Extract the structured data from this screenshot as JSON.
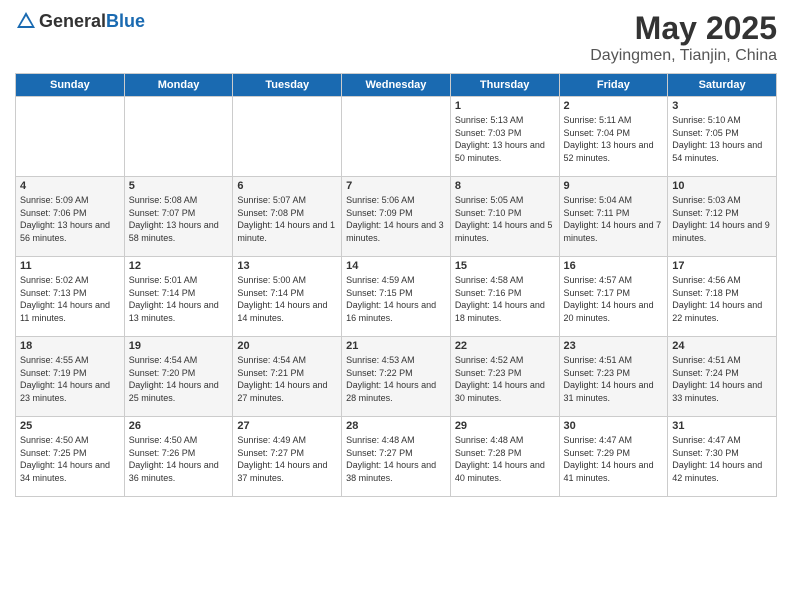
{
  "header": {
    "logo_general": "General",
    "logo_blue": "Blue",
    "month_title": "May 2025",
    "subtitle": "Dayingmen, Tianjin, China"
  },
  "days_of_week": [
    "Sunday",
    "Monday",
    "Tuesday",
    "Wednesday",
    "Thursday",
    "Friday",
    "Saturday"
  ],
  "weeks": [
    [
      {
        "day": "",
        "info": ""
      },
      {
        "day": "",
        "info": ""
      },
      {
        "day": "",
        "info": ""
      },
      {
        "day": "",
        "info": ""
      },
      {
        "day": "1",
        "info": "Sunrise: 5:13 AM\nSunset: 7:03 PM\nDaylight: 13 hours and 50 minutes."
      },
      {
        "day": "2",
        "info": "Sunrise: 5:11 AM\nSunset: 7:04 PM\nDaylight: 13 hours and 52 minutes."
      },
      {
        "day": "3",
        "info": "Sunrise: 5:10 AM\nSunset: 7:05 PM\nDaylight: 13 hours and 54 minutes."
      }
    ],
    [
      {
        "day": "4",
        "info": "Sunrise: 5:09 AM\nSunset: 7:06 PM\nDaylight: 13 hours and 56 minutes."
      },
      {
        "day": "5",
        "info": "Sunrise: 5:08 AM\nSunset: 7:07 PM\nDaylight: 13 hours and 58 minutes."
      },
      {
        "day": "6",
        "info": "Sunrise: 5:07 AM\nSunset: 7:08 PM\nDaylight: 14 hours and 1 minute."
      },
      {
        "day": "7",
        "info": "Sunrise: 5:06 AM\nSunset: 7:09 PM\nDaylight: 14 hours and 3 minutes."
      },
      {
        "day": "8",
        "info": "Sunrise: 5:05 AM\nSunset: 7:10 PM\nDaylight: 14 hours and 5 minutes."
      },
      {
        "day": "9",
        "info": "Sunrise: 5:04 AM\nSunset: 7:11 PM\nDaylight: 14 hours and 7 minutes."
      },
      {
        "day": "10",
        "info": "Sunrise: 5:03 AM\nSunset: 7:12 PM\nDaylight: 14 hours and 9 minutes."
      }
    ],
    [
      {
        "day": "11",
        "info": "Sunrise: 5:02 AM\nSunset: 7:13 PM\nDaylight: 14 hours and 11 minutes."
      },
      {
        "day": "12",
        "info": "Sunrise: 5:01 AM\nSunset: 7:14 PM\nDaylight: 14 hours and 13 minutes."
      },
      {
        "day": "13",
        "info": "Sunrise: 5:00 AM\nSunset: 7:14 PM\nDaylight: 14 hours and 14 minutes."
      },
      {
        "day": "14",
        "info": "Sunrise: 4:59 AM\nSunset: 7:15 PM\nDaylight: 14 hours and 16 minutes."
      },
      {
        "day": "15",
        "info": "Sunrise: 4:58 AM\nSunset: 7:16 PM\nDaylight: 14 hours and 18 minutes."
      },
      {
        "day": "16",
        "info": "Sunrise: 4:57 AM\nSunset: 7:17 PM\nDaylight: 14 hours and 20 minutes."
      },
      {
        "day": "17",
        "info": "Sunrise: 4:56 AM\nSunset: 7:18 PM\nDaylight: 14 hours and 22 minutes."
      }
    ],
    [
      {
        "day": "18",
        "info": "Sunrise: 4:55 AM\nSunset: 7:19 PM\nDaylight: 14 hours and 23 minutes."
      },
      {
        "day": "19",
        "info": "Sunrise: 4:54 AM\nSunset: 7:20 PM\nDaylight: 14 hours and 25 minutes."
      },
      {
        "day": "20",
        "info": "Sunrise: 4:54 AM\nSunset: 7:21 PM\nDaylight: 14 hours and 27 minutes."
      },
      {
        "day": "21",
        "info": "Sunrise: 4:53 AM\nSunset: 7:22 PM\nDaylight: 14 hours and 28 minutes."
      },
      {
        "day": "22",
        "info": "Sunrise: 4:52 AM\nSunset: 7:23 PM\nDaylight: 14 hours and 30 minutes."
      },
      {
        "day": "23",
        "info": "Sunrise: 4:51 AM\nSunset: 7:23 PM\nDaylight: 14 hours and 31 minutes."
      },
      {
        "day": "24",
        "info": "Sunrise: 4:51 AM\nSunset: 7:24 PM\nDaylight: 14 hours and 33 minutes."
      }
    ],
    [
      {
        "day": "25",
        "info": "Sunrise: 4:50 AM\nSunset: 7:25 PM\nDaylight: 14 hours and 34 minutes."
      },
      {
        "day": "26",
        "info": "Sunrise: 4:50 AM\nSunset: 7:26 PM\nDaylight: 14 hours and 36 minutes."
      },
      {
        "day": "27",
        "info": "Sunrise: 4:49 AM\nSunset: 7:27 PM\nDaylight: 14 hours and 37 minutes."
      },
      {
        "day": "28",
        "info": "Sunrise: 4:48 AM\nSunset: 7:27 PM\nDaylight: 14 hours and 38 minutes."
      },
      {
        "day": "29",
        "info": "Sunrise: 4:48 AM\nSunset: 7:28 PM\nDaylight: 14 hours and 40 minutes."
      },
      {
        "day": "30",
        "info": "Sunrise: 4:47 AM\nSunset: 7:29 PM\nDaylight: 14 hours and 41 minutes."
      },
      {
        "day": "31",
        "info": "Sunrise: 4:47 AM\nSunset: 7:30 PM\nDaylight: 14 hours and 42 minutes."
      }
    ]
  ]
}
